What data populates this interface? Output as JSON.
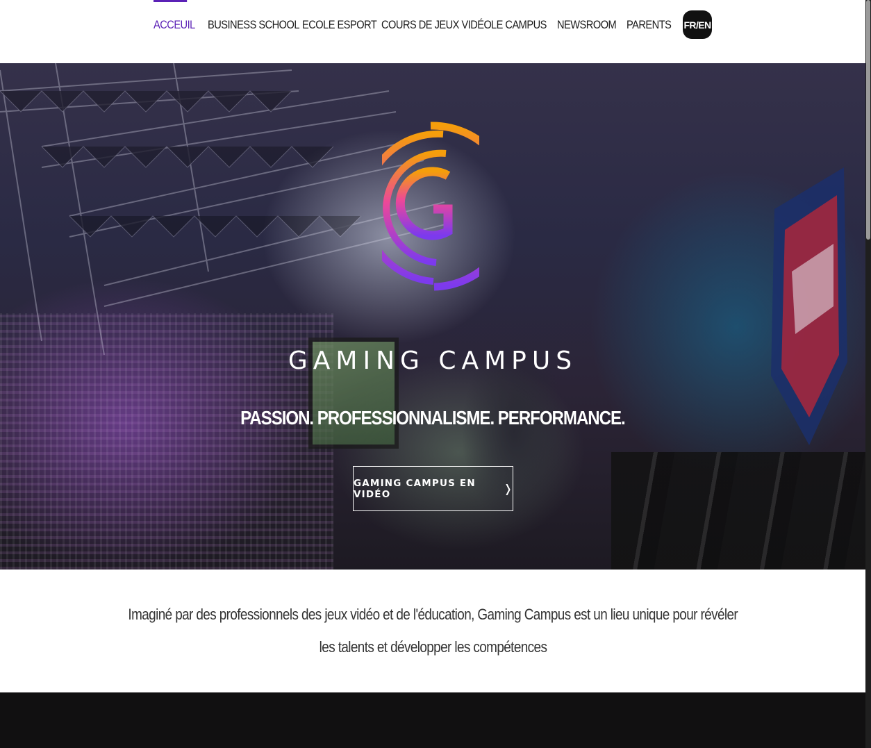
{
  "nav": {
    "items": [
      {
        "label": "ACCEUIL",
        "active": true
      },
      {
        "label": "BUSINESS SCHOOL"
      },
      {
        "label": "ECOLE ESPORT"
      },
      {
        "label": "COURS DE JEUX VIDÉO"
      },
      {
        "label": "LE CAMPUS"
      },
      {
        "label": "NEWSROOM"
      },
      {
        "label": "PARENTS"
      }
    ],
    "lang_label": "FR/EN",
    "active_color": "#5b21b6"
  },
  "hero": {
    "title": "GAMING CAMPUS",
    "tagline": "PASSION. PROFESSIONNALISME. PERFORMANCE.",
    "cta_label": "GAMING CAMPUS EN VIDÉO",
    "cta_icon": "chevron-right-icon",
    "logo_icon": "gaming-campus-g-logo",
    "logo_gradient": [
      "#f59e0b",
      "#ec4899",
      "#7c3aed"
    ]
  },
  "intro": {
    "line1": "Imaginé par des professionnels des jeux vidéo et de l'éducation, Gaming Campus est un lieu unique pour révéler",
    "line2": "les talents et développer les compétences"
  }
}
